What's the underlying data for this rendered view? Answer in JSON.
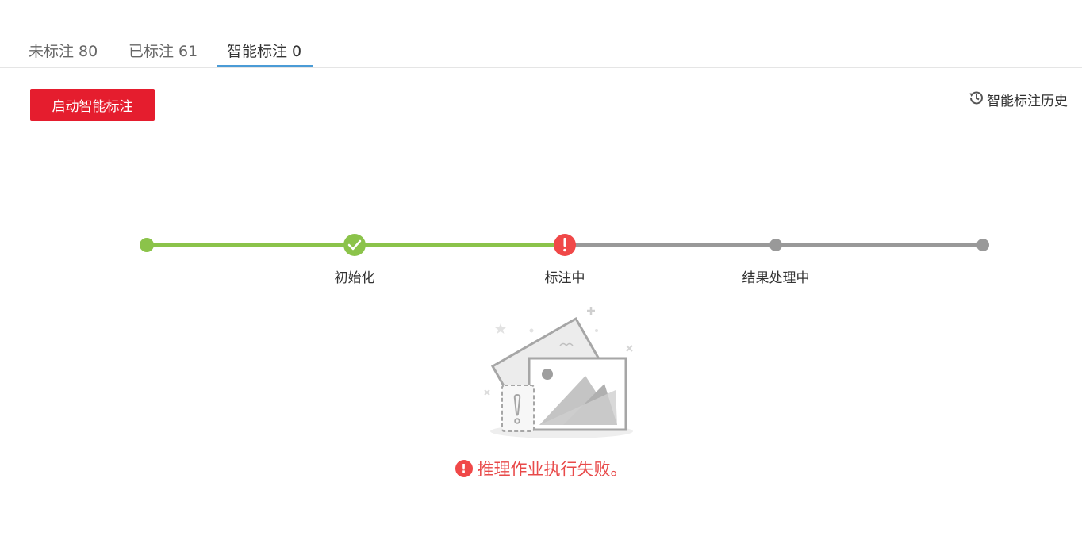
{
  "tabs": [
    {
      "label": "未标注 80"
    },
    {
      "label": "已标注 61"
    },
    {
      "label": "智能标注 0"
    }
  ],
  "toolbar": {
    "start_label": "启动智能标注",
    "history_label": "智能标注历史",
    "history_icon": "history-icon"
  },
  "steps": [
    {
      "label": "",
      "status": "done"
    },
    {
      "label": "初始化",
      "status": "done"
    },
    {
      "label": "标注中",
      "status": "error"
    },
    {
      "label": "结果处理中",
      "status": "pending"
    },
    {
      "label": "",
      "status": "pending"
    }
  ],
  "colors": {
    "accent": "#e51d2e",
    "done": "#8bc34a",
    "error": "#f04848",
    "pending": "#999999",
    "tab_indicator": "#4a9bd6"
  },
  "error": {
    "icon": "!",
    "message": "推理作业执行失败。"
  }
}
